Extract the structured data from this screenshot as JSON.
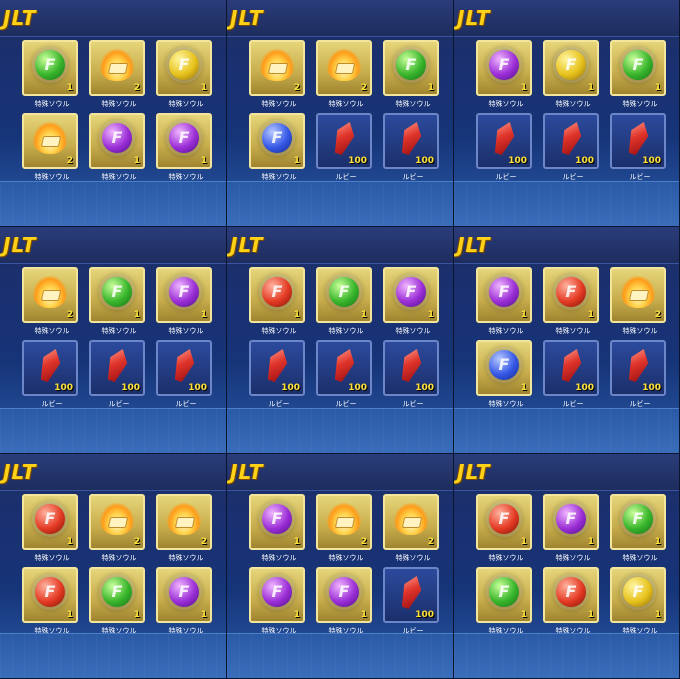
{
  "labels": {
    "special": "特殊ソウル",
    "ruby": "ルビー"
  },
  "panels": [
    {
      "title": "JLT",
      "items": [
        {
          "kind": "special",
          "icon": "green-soul-orb-icon",
          "color": "green",
          "count": "1"
        },
        {
          "kind": "special",
          "icon": "fire-soul-icon",
          "color": "fire",
          "count": "2"
        },
        {
          "kind": "special",
          "icon": "yellow-soul-orb-icon",
          "color": "yellow",
          "count": "1"
        },
        {
          "kind": "special",
          "icon": "fire-soul-icon",
          "color": "fire",
          "count": "2"
        },
        {
          "kind": "special",
          "icon": "purple-soul-orb-icon",
          "color": "purple",
          "count": "1"
        },
        {
          "kind": "special",
          "icon": "purple-soul-orb-icon",
          "color": "purple",
          "count": "1"
        }
      ]
    },
    {
      "title": "JLT",
      "items": [
        {
          "kind": "special",
          "icon": "fire-soul-icon",
          "color": "fire",
          "count": "2"
        },
        {
          "kind": "special",
          "icon": "fire-soul-icon",
          "color": "fire",
          "count": "2"
        },
        {
          "kind": "special",
          "icon": "green-soul-orb-icon",
          "color": "green",
          "count": "1"
        },
        {
          "kind": "special",
          "icon": "blue-soul-orb-icon",
          "color": "blue",
          "count": "1"
        },
        {
          "kind": "ruby",
          "icon": "ruby-gem-icon",
          "color": "ruby",
          "count": "100"
        },
        {
          "kind": "ruby",
          "icon": "ruby-gem-icon",
          "color": "ruby",
          "count": "100"
        }
      ]
    },
    {
      "title": "JLT",
      "items": [
        {
          "kind": "special",
          "icon": "purple-soul-orb-icon",
          "color": "purple",
          "count": "1"
        },
        {
          "kind": "special",
          "icon": "yellow-soul-orb-icon",
          "color": "yellow",
          "count": "1"
        },
        {
          "kind": "special",
          "icon": "green-soul-orb-icon",
          "color": "green",
          "count": "1"
        },
        {
          "kind": "ruby",
          "icon": "ruby-gem-icon",
          "color": "ruby",
          "count": "100"
        },
        {
          "kind": "ruby",
          "icon": "ruby-gem-icon",
          "color": "ruby",
          "count": "100"
        },
        {
          "kind": "ruby",
          "icon": "ruby-gem-icon",
          "color": "ruby",
          "count": "100"
        }
      ]
    },
    {
      "title": "JLT",
      "items": [
        {
          "kind": "special",
          "icon": "fire-soul-icon",
          "color": "fire",
          "count": "2"
        },
        {
          "kind": "special",
          "icon": "green-soul-orb-icon",
          "color": "green",
          "count": "1"
        },
        {
          "kind": "special",
          "icon": "purple-soul-orb-icon",
          "color": "purple",
          "count": "1"
        },
        {
          "kind": "ruby",
          "icon": "ruby-gem-icon",
          "color": "ruby",
          "count": "100"
        },
        {
          "kind": "ruby",
          "icon": "ruby-gem-icon",
          "color": "ruby",
          "count": "100"
        },
        {
          "kind": "ruby",
          "icon": "ruby-gem-icon",
          "color": "ruby",
          "count": "100"
        }
      ]
    },
    {
      "title": "JLT",
      "items": [
        {
          "kind": "special",
          "icon": "red-soul-orb-icon",
          "color": "red",
          "count": "1"
        },
        {
          "kind": "special",
          "icon": "green-soul-orb-icon",
          "color": "green",
          "count": "1"
        },
        {
          "kind": "special",
          "icon": "purple-soul-orb-icon",
          "color": "purple",
          "count": "1"
        },
        {
          "kind": "ruby",
          "icon": "ruby-gem-icon",
          "color": "ruby",
          "count": "100"
        },
        {
          "kind": "ruby",
          "icon": "ruby-gem-icon",
          "color": "ruby",
          "count": "100"
        },
        {
          "kind": "ruby",
          "icon": "ruby-gem-icon",
          "color": "ruby",
          "count": "100"
        }
      ]
    },
    {
      "title": "JLT",
      "items": [
        {
          "kind": "special",
          "icon": "purple-soul-orb-icon",
          "color": "purple",
          "count": "1"
        },
        {
          "kind": "special",
          "icon": "red-soul-orb-icon",
          "color": "red",
          "count": "1"
        },
        {
          "kind": "special",
          "icon": "fire-soul-icon",
          "color": "fire",
          "count": "2"
        },
        {
          "kind": "special",
          "icon": "blue-soul-orb-icon",
          "color": "blue",
          "count": "1"
        },
        {
          "kind": "ruby",
          "icon": "ruby-gem-icon",
          "color": "ruby",
          "count": "100"
        },
        {
          "kind": "ruby",
          "icon": "ruby-gem-icon",
          "color": "ruby",
          "count": "100"
        }
      ]
    },
    {
      "title": "JLT",
      "items": [
        {
          "kind": "special",
          "icon": "red-soul-orb-icon",
          "color": "red",
          "count": "1"
        },
        {
          "kind": "special",
          "icon": "fire-soul-icon",
          "color": "fire",
          "count": "2"
        },
        {
          "kind": "special",
          "icon": "fire-soul-icon",
          "color": "fire",
          "count": "2"
        },
        {
          "kind": "special",
          "icon": "red-soul-orb-icon",
          "color": "red",
          "count": "1"
        },
        {
          "kind": "special",
          "icon": "green-soul-orb-icon",
          "color": "green",
          "count": "1"
        },
        {
          "kind": "special",
          "icon": "purple-soul-orb-icon",
          "color": "purple",
          "count": "1"
        }
      ]
    },
    {
      "title": "JLT",
      "items": [
        {
          "kind": "special",
          "icon": "purple-soul-orb-icon",
          "color": "purple",
          "count": "1"
        },
        {
          "kind": "special",
          "icon": "fire-soul-icon",
          "color": "fire",
          "count": "2"
        },
        {
          "kind": "special",
          "icon": "fire-soul-icon",
          "color": "fire",
          "count": "2"
        },
        {
          "kind": "special",
          "icon": "purple-soul-orb-icon",
          "color": "purple",
          "count": "1"
        },
        {
          "kind": "special",
          "icon": "purple-soul-orb-icon",
          "color": "purple",
          "count": "1"
        },
        {
          "kind": "ruby",
          "icon": "ruby-gem-icon",
          "color": "ruby",
          "count": "100"
        }
      ]
    },
    {
      "title": "JLT",
      "items": [
        {
          "kind": "special",
          "icon": "red-soul-orb-icon",
          "color": "red",
          "count": "1"
        },
        {
          "kind": "special",
          "icon": "purple-soul-orb-icon",
          "color": "purple",
          "count": "1"
        },
        {
          "kind": "special",
          "icon": "green-soul-orb-icon",
          "color": "green",
          "count": "1"
        },
        {
          "kind": "special",
          "icon": "green-soul-orb-icon",
          "color": "green",
          "count": "1"
        },
        {
          "kind": "special",
          "icon": "red-soul-orb-icon",
          "color": "red",
          "count": "1"
        },
        {
          "kind": "special",
          "icon": "yellow-soul-orb-icon",
          "color": "yellow",
          "count": "1"
        }
      ]
    }
  ]
}
